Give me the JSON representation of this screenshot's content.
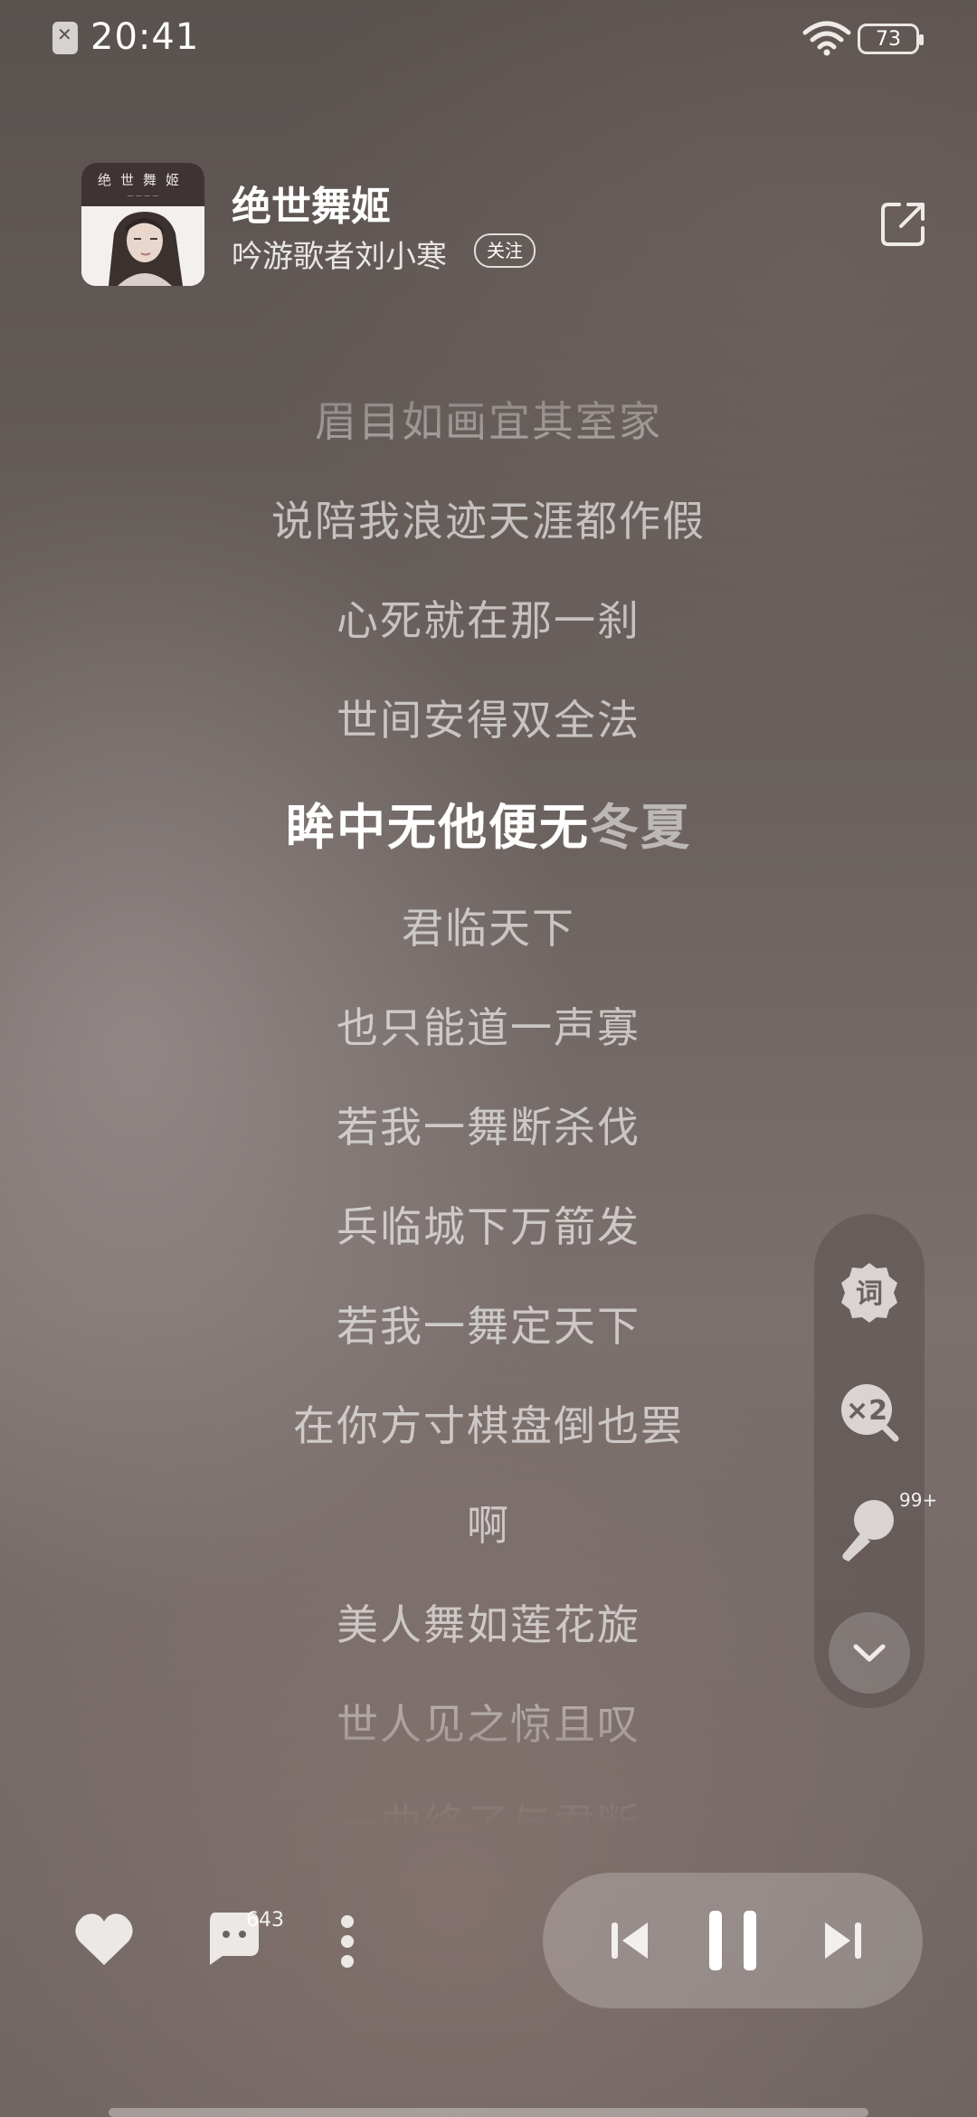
{
  "status_bar": {
    "time": "20:41",
    "battery_level": "73"
  },
  "song": {
    "cover_title": "绝世舞姬",
    "title": "绝世舞姬",
    "artist": "吟游歌者刘小寒",
    "follow_label": "关注"
  },
  "lyrics": {
    "lines": [
      "眉目如画宜其室家",
      "说陪我浪迹天涯都作假",
      "心死就在那一刹",
      "世间安得双全法",
      "眸中无他便无冬夏",
      "君临天下",
      "也只能道一声寡",
      "若我一舞断杀伐",
      "兵临城下万箭发",
      "若我一舞定天下",
      "在你方寸棋盘倒也罢",
      "啊",
      "美人舞如莲花旋",
      "世人见之惊且叹",
      "一曲终了与君断"
    ],
    "current_index": 4,
    "current_sung": "眸中无他便无",
    "current_unsung": "冬夏"
  },
  "side_panel": {
    "lyrics_icon_label": "词",
    "speed_label": "×2",
    "karaoke_badge": "99+"
  },
  "bottom": {
    "comment_count": "643"
  }
}
